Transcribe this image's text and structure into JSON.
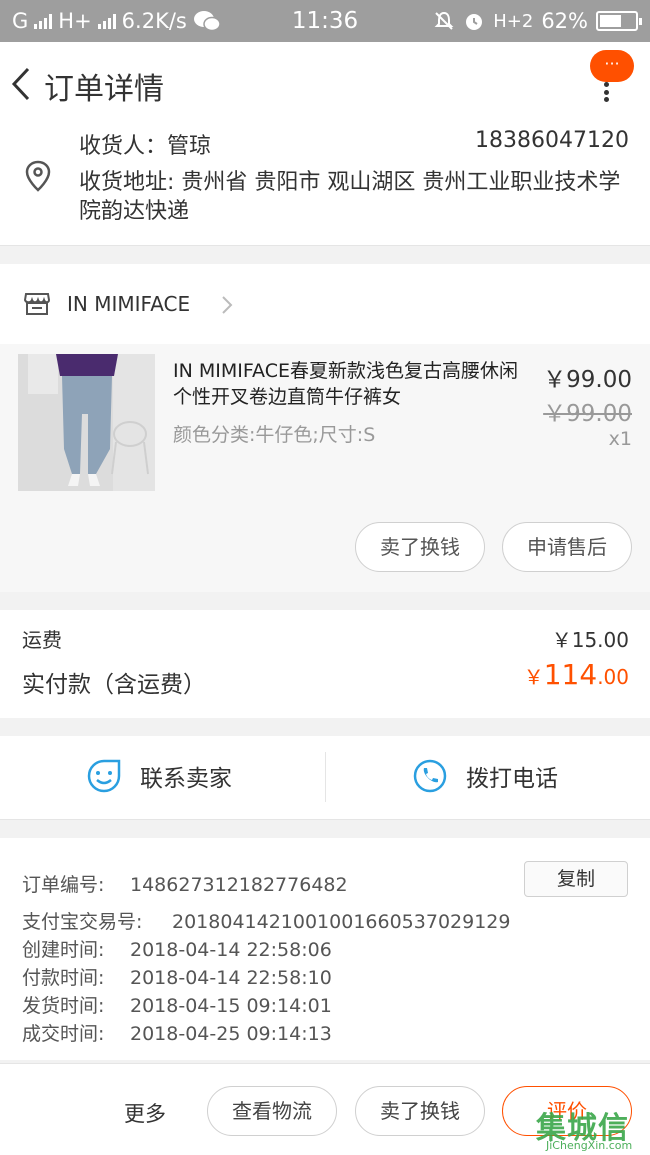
{
  "status_bar": {
    "network": "G",
    "network2": "H+",
    "speed": "6.2K/s",
    "time": "11:36",
    "network3": "H+2",
    "battery": "62%",
    "battery_level": 0.62
  },
  "nav": {
    "title": "订单详情",
    "message_bubble": "···"
  },
  "address": {
    "name_label": "收货人：",
    "name": "管琼",
    "phone": "18386047120",
    "address_label": "收货地址:",
    "address": "贵州省 贵阳市 观山湖区 贵州工业职业技术学院韵达快递"
  },
  "shop": {
    "name": "IN MIMIFACE"
  },
  "item": {
    "title": "IN MIMIFACE春夏新款浅色复古高腰休闲个性开叉卷边直筒牛仔裤女",
    "sku": "颜色分类:牛仔色;尺寸:S",
    "price": "￥99.00",
    "original_price": "￥99.00",
    "quantity": "x1",
    "sell_button": "卖了换钱",
    "after_sale_button": "申请售后"
  },
  "fees": {
    "shipping_label": "运费",
    "shipping_value": "￥15.00",
    "total_label": "实付款（含运费）",
    "total_currency": "￥",
    "total_int": "114",
    "total_dec": ".00"
  },
  "contact": {
    "seller_label": "联系卖家",
    "call_label": "拨打电话"
  },
  "order_info": {
    "order_no_label": "订单编号:",
    "order_no": "148627312182776482",
    "copy_button": "复制",
    "alipay_label": "支付宝交易号:",
    "alipay_no": "2018041421001001660537029129",
    "created_label": "创建时间:",
    "created": "2018-04-14 22:58:06",
    "paid_label": "付款时间:",
    "paid": "2018-04-14 22:58:10",
    "shipped_label": "发货时间:",
    "shipped": "2018-04-15 09:14:01",
    "closed_label": "成交时间:",
    "closed": "2018-04-25 09:14:13"
  },
  "bottom_bar": {
    "more": "更多",
    "logistics": "查看物流",
    "sell": "卖了换钱",
    "rate": "评价"
  },
  "watermark": {
    "main": "集城信",
    "sub": "JiChengXin.com"
  },
  "colors": {
    "accent": "#ff5000",
    "icon_blue": "#2a9fe0",
    "status_bar": "#9e9e9e"
  },
  "icons": [
    "back-arrow-icon",
    "location-pin-icon",
    "shop-icon",
    "chevron-right-icon",
    "smile-chat-icon",
    "phone-icon",
    "more-icon"
  ]
}
